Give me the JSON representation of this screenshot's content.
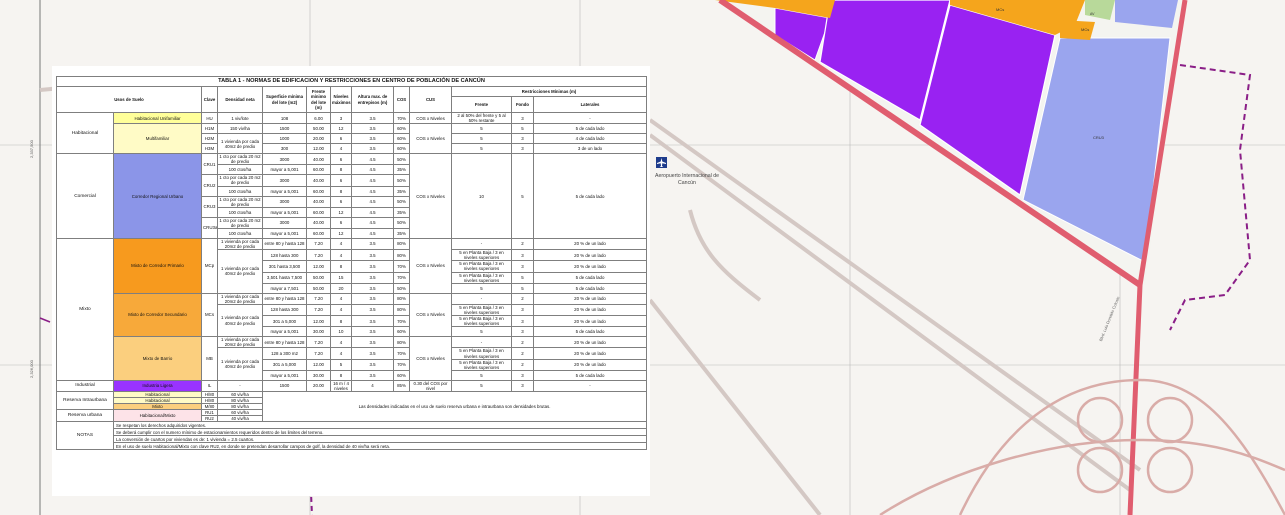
{
  "map": {
    "coord_labels": [
      "2,337,500",
      "2,326,000"
    ],
    "airport_label": "Aeropuerto Internacional de Cancún",
    "road_label": "Blvd. Luis Donaldo Colosio",
    "zone_labels": [
      "CRU3",
      "MCs",
      "MCs",
      "AV"
    ],
    "colors": {
      "purple": "#9922f2",
      "lavender": "#9aa5ee",
      "orange": "#f5a51c",
      "road": "#e05d6f",
      "green": "#b8d99a"
    }
  },
  "table": {
    "title": "TABLA 1 - NORMAS DE EDIFICACION Y RESTRICCIONES EN CENTRO DE POBLACIÓN DE CANCÚN",
    "headers": {
      "usos": "Usos de Suelo",
      "clave": "Clave",
      "densidad": "Densidad neta",
      "superficie": "Superficie mínima del lote (m2)",
      "frente": "Frente mínimo del lote (m)",
      "niveles": "Niveles máximos",
      "altura": "Altura max. de entrepisos (m)",
      "cos": "COS",
      "cus": "CUS",
      "restricciones": "Restricciones Mínimas (m)",
      "r_frente": "Frente",
      "r_fondo": "Fondo",
      "r_laterales": "Laterales"
    },
    "categories": {
      "habitacional": "Habitacional",
      "comercial": "Comercial",
      "mixto": "Mixto",
      "industrial": "Industrial",
      "reserva_intra": "Reserva Intraurbana",
      "reserva_urbana": "Reserva urbana",
      "notas": "NOTAS"
    },
    "subcats": {
      "hu": "Habitacional Unifamiliar",
      "multi": "Multifamiliar",
      "cru": "Corredor Regional Urbano",
      "mcp": "Mixto de Corredor Primario",
      "mcs": "Mixto de Corredor Secundario",
      "mb": "Mixto de Barrio",
      "il": "Industria Ligera"
    },
    "rows": {
      "hu": [
        "HU",
        "1 viv/lote",
        "108",
        "6.00",
        "3",
        "3.5",
        "70%",
        "COS x Niveles",
        "2 al 50% del frente y 5 al 50% restante",
        "3",
        "-"
      ],
      "h1m": [
        "H1M",
        "150 viv/ha",
        "1500",
        "50.00",
        "12",
        "3.5",
        "60%",
        "5",
        "5",
        "5 de cada lado"
      ],
      "h2m": [
        "H2M",
        "1000",
        "20.00",
        "6",
        "3.5",
        "60%",
        "5",
        "3",
        "4 de cada lado"
      ],
      "h3m": [
        "H3M",
        "300",
        "12.00",
        "4",
        "3.5",
        "60%",
        "5",
        "3",
        "3 de un lado"
      ],
      "h23_dens": "1 vivienda por cada 40m2 de predio",
      "h23_cus": "COS x Niveles",
      "cru1a": [
        "CRU1",
        "1 cto por cada 20 m2 de predio",
        "3000",
        "40.00",
        "6",
        "4.5",
        "50%"
      ],
      "cru1b": [
        "100 ctos/ha",
        "mayor a 5,001",
        "60.00",
        "8",
        "4.5",
        "35%"
      ],
      "cru2a": [
        "CRU2",
        "1 cto por cada 20 m2 de predio",
        "3000",
        "40.00",
        "6",
        "4.5",
        "50%"
      ],
      "cru2b": [
        "100 ctos/ha",
        "mayor a 5,001",
        "60.00",
        "8",
        "4.5",
        "35%"
      ],
      "cru3a": [
        "CRU3",
        "1 cto por cada 20 m2 de predio",
        "3000",
        "40.00",
        "6",
        "4.5",
        "50%"
      ],
      "cru3b": [
        "100 ctos/ha",
        "mayor a 5,001",
        "60.00",
        "12",
        "4.5",
        "35%"
      ],
      "cru3aa": [
        "CRU3a",
        "1 cto por cada 20 m2 de predio",
        "3000",
        "40.00",
        "6",
        "4.5",
        "50%"
      ],
      "cru3ab": [
        "100 ctos/ha",
        "mayor a 5,001",
        "60.00",
        "12",
        "4.5",
        "35%"
      ],
      "cru_cus": "COS x Niveles",
      "cru_rest": [
        "10",
        "5",
        "5 de cada lado"
      ],
      "mcp_clave": "MCp",
      "mcp_dens1": "1 vivienda por cada 20m2 de predio",
      "mcp_dens2": "1 vivienda por cada 40m2 de predio",
      "mcp": [
        [
          "entre 80 y hasta 128",
          "7.20",
          "4",
          "3.5",
          "80%",
          "-",
          "2",
          "20 % de un lado"
        ],
        [
          "128 hasta 300",
          "7.20",
          "4",
          "3.5",
          "80%",
          "5 en Planta Baja / 3 en niveles superiores",
          "3",
          "20 % de un lado"
        ],
        [
          "301 hasta 3,500",
          "12.00",
          "8",
          "3.5",
          "70%",
          "5 en Planta Baja / 3 en niveles superiores",
          "3",
          "20 % de un lado"
        ],
        [
          "3,501 hasta 7,500",
          "50.00",
          "15",
          "3.5",
          "70%",
          "5 en Planta Baja / 3 en niveles superiores",
          "5",
          "5 de cada lado"
        ],
        [
          "mayor a 7,501",
          "50.00",
          "20",
          "3.5",
          "50%",
          "5",
          "5",
          "5 de cada lado"
        ]
      ],
      "mcs_clave": "MCs",
      "mcs_dens1": "1 vivienda por cada 20m2 de predio",
      "mcs_dens2": "1 vivienda por cada 40m2 de predio",
      "mcs": [
        [
          "entre 80 y hasta 128",
          "7.20",
          "4",
          "3.5",
          "80%",
          "-",
          "2",
          "20 % de un lado"
        ],
        [
          "128 hasta 300",
          "7.20",
          "4",
          "3.5",
          "80%",
          "5 en Planta Baja / 3 en niveles superiores",
          "3",
          "20 % de un lado"
        ],
        [
          "301 a 5,000",
          "12.00",
          "8",
          "3.5",
          "70%",
          "5 en Planta Baja / 3 en niveles superiores",
          "3",
          "20 % de un lado"
        ],
        [
          "mayor a 5,001",
          "30.00",
          "10",
          "3.5",
          "60%",
          "5",
          "3",
          "5 de cada lado"
        ]
      ],
      "mb_clave": "MB",
      "mb_dens1": "1 vivienda por cada 20m2 de predio",
      "mb_dens2": "1 vivienda por cada 40m2 de predio",
      "mb": [
        [
          "entre 80 y hasta 128",
          "7.20",
          "4",
          "3.5",
          "80%",
          "-",
          "2",
          "20 % de un lado"
        ],
        [
          "128 a 300 m2",
          "7.20",
          "4",
          "3.5",
          "70%",
          "5 en Planta Baja / 3 en niveles superiores",
          "2",
          "20 % de un lado"
        ],
        [
          "301 a 5,000",
          "12.00",
          "5",
          "3.5",
          "70%",
          "5 en Planta Baja / 3 en niveles superiores",
          "2",
          "20 % de un lado"
        ],
        [
          "mayor a 5,001",
          "30.00",
          "8",
          "3.5",
          "60%",
          "5",
          "3",
          "5 de cada lado"
        ]
      ],
      "mixto_cus": "COS x Niveles",
      "il": [
        "IL",
        "-",
        "1500",
        "20.00",
        "16 m / 4 niveles",
        "4",
        "85%",
        "0.30 del COS por nivel",
        "5",
        "3",
        "-"
      ],
      "reserva": [
        [
          "Habitacional",
          "H/80",
          "60 viv/ha"
        ],
        [
          "Habitacional",
          "H/80",
          "80 viv/ha"
        ],
        [
          "Mixto",
          "M/80",
          "80 viv/ha"
        ],
        [
          "Habitacional/Mixto",
          "RU1",
          "60 viv/ha"
        ],
        [
          "",
          "RU2",
          "40 viv/ha"
        ]
      ],
      "reserva_note": "Las densidades indicadas en el uso de suelo reserva urbana e intraurbana son densidades brutas."
    },
    "notes": [
      "Se respetan los derechos adquiridos vigentes.",
      "Se deberá cumplir con el numero mínimo de estacionamientos requeridos dentro de los limites del terreno.",
      "La conversión de cuartos por viviendas es de: 1 vivienda = 2.5 cuartos.",
      "En el uso de suelo Habitacional/Mixto con clave RU2, en donde se pretendan desarrollar campos de golf, la densidad de 40 viv/ha será neta."
    ]
  }
}
